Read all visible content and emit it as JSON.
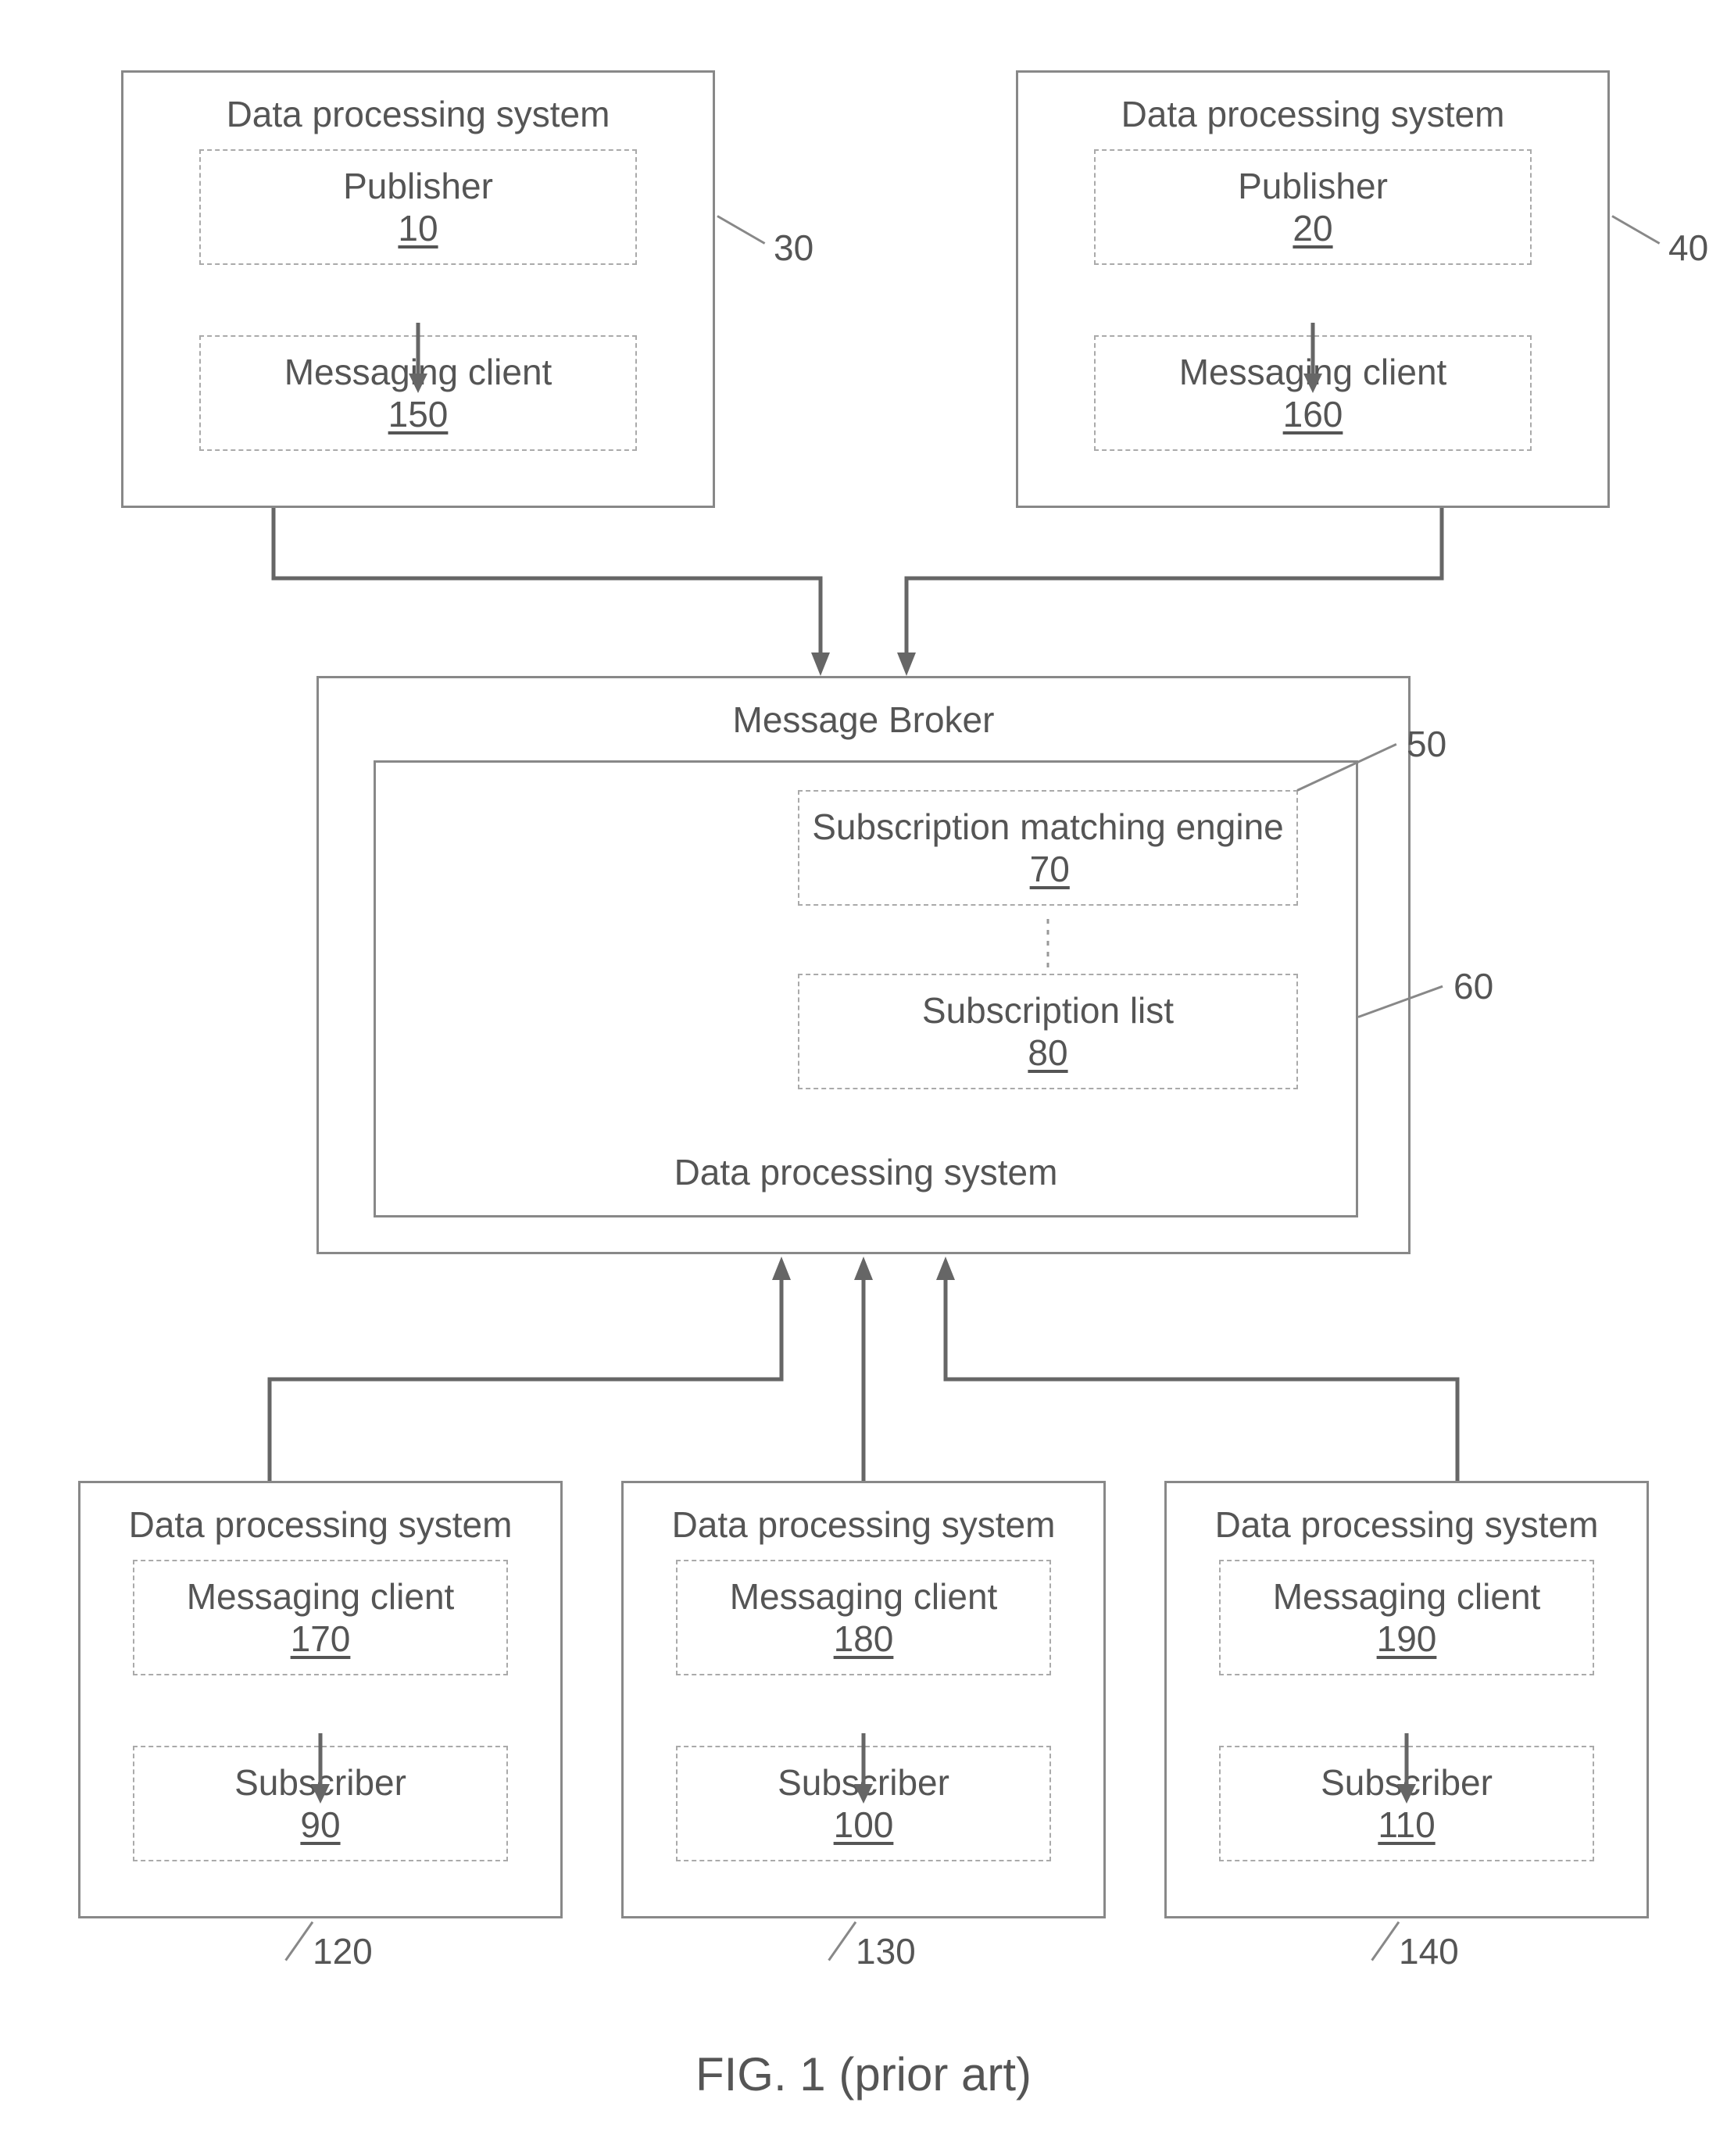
{
  "figure_caption": "FIG. 1 (prior art)",
  "publishers": {
    "left": {
      "outer_title": "Data processing system",
      "pub_title": "Publisher",
      "pub_ref": "10",
      "client_title": "Messaging client",
      "client_ref": "150",
      "outer_ref": "30"
    },
    "right": {
      "outer_title": "Data processing system",
      "pub_title": "Publisher",
      "pub_ref": "20",
      "client_title": "Messaging client",
      "client_ref": "160",
      "outer_ref": "40"
    }
  },
  "broker": {
    "outer_title": "Message Broker",
    "outer_ref": "50",
    "dps_title": "Data processing system",
    "dps_ref": "60",
    "engine_title": "Subscription matching engine",
    "engine_ref": "70",
    "list_title": "Subscription list",
    "list_ref": "80"
  },
  "subscribers": {
    "left": {
      "outer_title": "Data processing system",
      "client_title": "Messaging client",
      "client_ref": "170",
      "sub_title": "Subscriber",
      "sub_ref": "90",
      "outer_ref": "120"
    },
    "mid": {
      "outer_title": "Data processing system",
      "client_title": "Messaging client",
      "client_ref": "180",
      "sub_title": "Subscriber",
      "sub_ref": "100",
      "outer_ref": "130"
    },
    "right": {
      "outer_title": "Data processing system",
      "client_title": "Messaging client",
      "client_ref": "190",
      "sub_title": "Subscriber",
      "sub_ref": "110",
      "outer_ref": "140"
    }
  }
}
